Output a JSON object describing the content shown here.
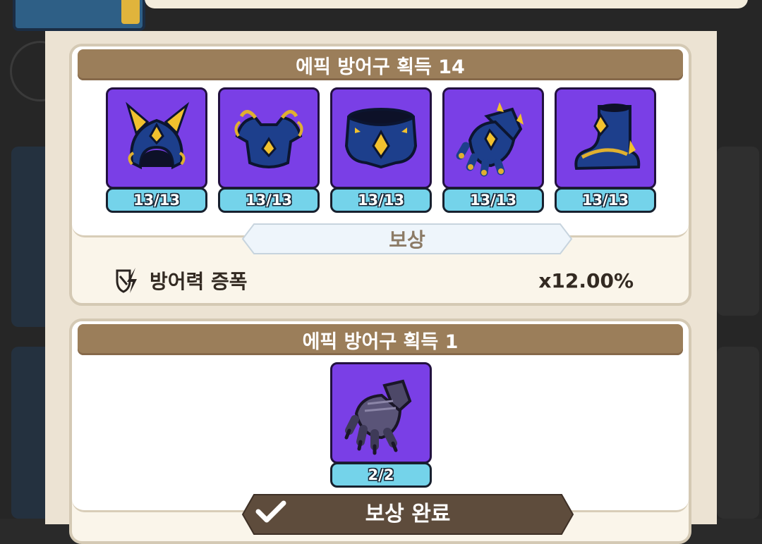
{
  "colors": {
    "header_brown": "#9b7e5a",
    "item_purple": "#7a3fe6",
    "count_cyan": "#74d3ea",
    "card_cream": "#faf5ea"
  },
  "collections": [
    {
      "title": "에픽 방어구 획득 14",
      "items": [
        {
          "icon": "epic-helmet-icon",
          "count": "13/13"
        },
        {
          "icon": "epic-chest-armor-icon",
          "count": "13/13"
        },
        {
          "icon": "epic-belt-icon",
          "count": "13/13"
        },
        {
          "icon": "epic-gauntlet-icon",
          "count": "13/13"
        },
        {
          "icon": "epic-boots-icon",
          "count": "13/13"
        }
      ],
      "reward_label": "보상",
      "reward": {
        "icon": "defense-boost-icon",
        "name": "방어력 증폭",
        "value": "x12.00%"
      }
    },
    {
      "title": "에픽 방어구 획득 1",
      "items": [
        {
          "icon": "dark-gauntlet-icon",
          "count": "2/2"
        }
      ],
      "status_label": "보상 완료",
      "status_icon": "checkmark-icon"
    }
  ]
}
